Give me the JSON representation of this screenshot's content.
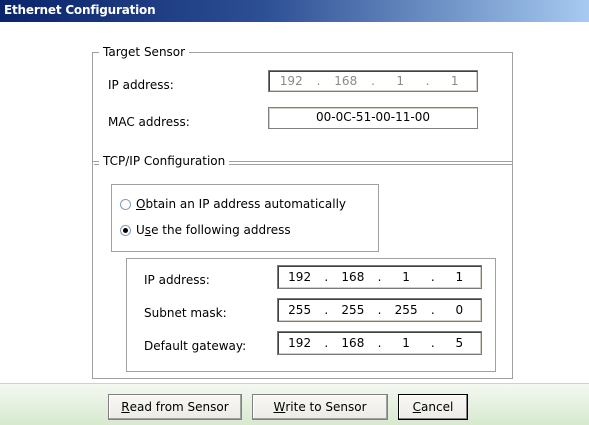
{
  "window": {
    "title": "Ethernet Configuration"
  },
  "target_sensor": {
    "legend": "Target Sensor",
    "ip_label": "IP address:",
    "ip": [
      "192",
      "168",
      "1",
      "1"
    ],
    "mac_label": "MAC address:",
    "mac": "00-0C-51-00-11-00"
  },
  "tcpip": {
    "legend": "TCP/IP Configuration",
    "radio_auto": {
      "accel": "O",
      "rest": "btain an IP address automatically",
      "checked": false
    },
    "radio_manual": {
      "pre": "U",
      "accel": "s",
      "rest": "e the following address",
      "checked": true
    },
    "ip_label": "IP address:",
    "ip": [
      "192",
      "168",
      "1",
      "1"
    ],
    "subnet_label": "Subnet mask:",
    "subnet": [
      "255",
      "255",
      "255",
      "0"
    ],
    "gateway_label": "Default gateway:",
    "gateway": [
      "192",
      "168",
      "1",
      "5"
    ]
  },
  "buttons": {
    "read": {
      "accel": "R",
      "rest": "ead from Sensor"
    },
    "write": {
      "accel": "W",
      "rest": "rite to Sensor"
    },
    "cancel": {
      "accel": "C",
      "rest": "ancel"
    }
  }
}
